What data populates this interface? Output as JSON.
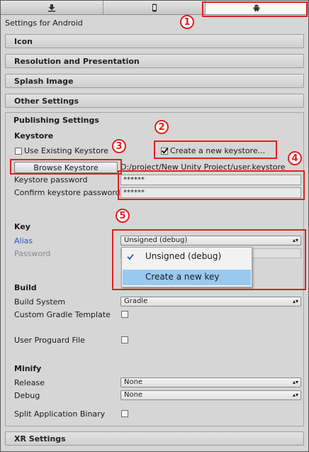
{
  "tabs": [
    {
      "name": "download-icon"
    },
    {
      "name": "mobile-icon"
    },
    {
      "name": "android-icon"
    }
  ],
  "header": {
    "title": "Settings for Android"
  },
  "sections": {
    "icon": "Icon",
    "resolution": "Resolution and Presentation",
    "splash": "Splash Image",
    "other": "Other Settings",
    "publishing": "Publishing Settings",
    "xr": "XR Settings"
  },
  "keystore": {
    "heading": "Keystore",
    "use_existing": "Use Existing Keystore",
    "create_new": "Create a new keystore...",
    "browse": "Browse Keystore",
    "path": "D:/project/New Unity Project/user.keystore",
    "password_label": "Keystore password",
    "password_value": "******",
    "confirm_label": "Confirm keystore password",
    "confirm_value": "******"
  },
  "key": {
    "heading": "Key",
    "alias_label": "Alias",
    "alias_value": "Unsigned (debug)",
    "password_label": "Password"
  },
  "alias_popup": {
    "options": [
      "Unsigned (debug)",
      "Create a new key"
    ]
  },
  "build": {
    "heading": "Build",
    "system_label": "Build System",
    "system_value": "Gradle",
    "custom_gradle": "Custom Gradle Template",
    "proguard": "User Proguard File"
  },
  "minify": {
    "heading": "Minify",
    "release_label": "Release",
    "release_value": "None",
    "debug_label": "Debug",
    "debug_value": "None",
    "split": "Split Application Binary"
  },
  "annotations": [
    "1",
    "2",
    "3",
    "4",
    "5"
  ],
  "colors": {
    "annotation": "#e02020",
    "highlight": "#99c9ef",
    "alias_label": "#2b57c8"
  }
}
